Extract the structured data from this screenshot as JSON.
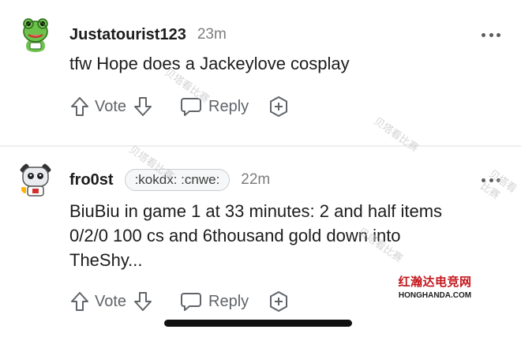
{
  "comments": [
    {
      "username": "Justatourist123",
      "time": "23m",
      "flair": "",
      "text": "tfw Hope does a Jackeylove cosplay",
      "vote_label": "Vote",
      "reply_label": "Reply"
    },
    {
      "username": "fro0st",
      "time": "22m",
      "flair": ":kokdx: :cnwe:",
      "text": "BiuBiu in game 1 at 33 minutes: 2 and half items 0/2/0 100 cs and 6thousand gold down into TheShy...",
      "vote_label": "Vote",
      "reply_label": "Reply"
    }
  ],
  "watermark": {
    "text": "贝塔看比赛",
    "site_name": "红瀚达电竞网",
    "site_domain": "HONGHANDA.COM"
  },
  "colors": {
    "text": "#1c1c1c",
    "muted": "#7c7c7c",
    "icon": "#606468",
    "site_red": "#c4161c"
  }
}
